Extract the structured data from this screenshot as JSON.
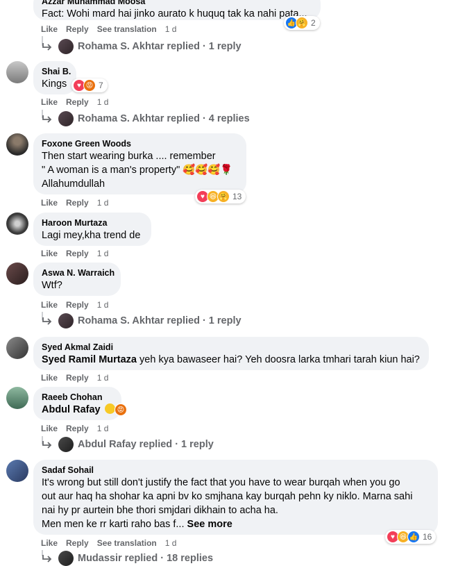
{
  "comments": [
    {
      "name": "Azzar Muhammad Moosa",
      "text": "Fact: Wohi mard hai jinko aurato k huquq tak ka nahi pata...",
      "actions": {
        "like": "Like",
        "reply": "Reply",
        "translate": "See translation",
        "time": "1 d"
      },
      "reactions": {
        "count": "2"
      },
      "reply_summary": "Rohama S. Akhtar replied · 1 reply"
    },
    {
      "name": "Shai B.",
      "text": "Kings",
      "actions": {
        "like": "Like",
        "reply": "Reply",
        "time": "1 d"
      },
      "reactions": {
        "count": "7"
      },
      "reply_summary": "Rohama S. Akhtar replied · 4 replies"
    },
    {
      "name": "Foxone Green Woods",
      "lines": [
        "Then start wearing burka .... remember",
        "\" A woman is a man's property\" 🥰🥰🥰🌹",
        "Allahumdullah"
      ],
      "actions": {
        "like": "Like",
        "reply": "Reply",
        "time": "1 d"
      },
      "reactions": {
        "count": "13"
      }
    },
    {
      "name": "Haroon Murtaza",
      "text": "Lagi mey,kha trend de",
      "actions": {
        "like": "Like",
        "reply": "Reply",
        "time": "1 d"
      }
    },
    {
      "name": "Aswa N. Warraich",
      "text": "Wtf?",
      "actions": {
        "like": "Like",
        "reply": "Reply",
        "time": "1 d"
      },
      "reply_summary": "Rohama S. Akhtar replied · 1 reply"
    },
    {
      "name": "Syed Akmal Zaidi",
      "mention": "Syed Ramil Murtaza",
      "text": "yeh kya bawaseer hai? Yeh doosra larka tmhari tarah kiun hai?",
      "actions": {
        "like": "Like",
        "reply": "Reply",
        "time": "1 d"
      }
    },
    {
      "name": "Raeeb Chohan",
      "mention": "Abdul Rafay",
      "actions": {
        "like": "Like",
        "reply": "Reply",
        "time": "1 d"
      },
      "reply_summary": "Abdul Rafay replied · 1 reply"
    },
    {
      "name": "Sadaf Sohail",
      "lines": [
        "It's wrong but still don't justify the fact that you have to wear burqah when you go",
        "out aur haq ha shohar ka apni bv ko smjhana kay burqah pehn ky niklo. Marna sahi",
        "nai hy pr aurtein bhe thori smjdari dikhain to acha ha.",
        "Men men ke rr karti raho bas f..."
      ],
      "see_more": "See more",
      "actions": {
        "like": "Like",
        "reply": "Reply",
        "translate": "See translation",
        "time": "1 d"
      },
      "reactions": {
        "count": "16"
      },
      "reply_summary": "Mudassir replied · 18 replies"
    }
  ],
  "colors": {
    "bubble": "#f0f2f5",
    "secondary_text": "#65676b",
    "like_blue": "#1877f2",
    "love_red": "#f33e58",
    "haha_yellow": "#f7b125"
  }
}
